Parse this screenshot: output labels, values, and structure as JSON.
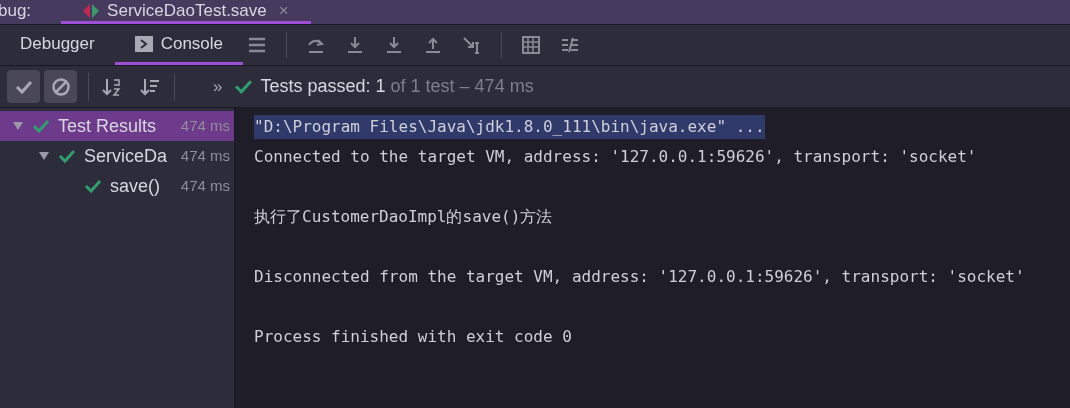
{
  "header": {
    "label": "bug:",
    "tab": {
      "title": "ServiceDaoTest.save",
      "selected": true,
      "close": "×"
    }
  },
  "tabs": [
    {
      "label": "Debugger",
      "selected": false,
      "icon": false
    },
    {
      "label": "Console",
      "selected": true,
      "icon": true
    }
  ],
  "toolbar": {
    "toggles": [
      {
        "kind": "passed",
        "on": true
      },
      {
        "kind": "ignored",
        "on": true
      }
    ],
    "expand": "»",
    "status": {
      "strong": "Tests passed: 1",
      "rest": "of 1 test – 474 ms"
    }
  },
  "tree": [
    {
      "label": "Test Results",
      "time": "474 ms",
      "selected": true,
      "expanded": true,
      "children": [
        {
          "label": "ServiceDa",
          "time": "474 ms",
          "selected": false,
          "expanded": true,
          "children": [
            {
              "label": "save()",
              "time": "474 ms",
              "selected": false
            }
          ]
        }
      ]
    }
  ],
  "console": [
    {
      "kind": "text",
      "text": "\"D:\\Program Files\\Java\\jdk1.8.0_111\\bin\\java.exe\" ...",
      "selected": true
    },
    {
      "kind": "text",
      "text": "Connected to the target VM, address: '127.0.0.1:59626', transport: 'socket'",
      "selected": false
    },
    {
      "kind": "blank"
    },
    {
      "kind": "text",
      "text": "执行了CustomerDaoImpl的save()方法",
      "selected": false
    },
    {
      "kind": "blank"
    },
    {
      "kind": "text",
      "text": "Disconnected from the target VM, address: '127.0.0.1:59626', transport: 'socket'",
      "selected": false
    },
    {
      "kind": "blank"
    },
    {
      "kind": "text",
      "text": "Process finished with exit code 0",
      "selected": false
    }
  ]
}
